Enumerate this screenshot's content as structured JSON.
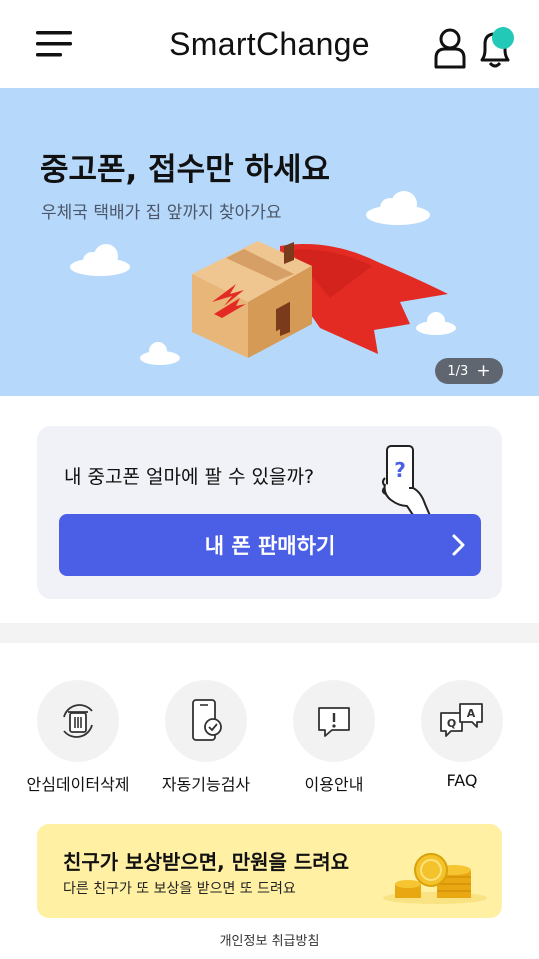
{
  "header": {
    "title": "SmartChange",
    "menu_icon": "hamburger-menu-icon",
    "user_icon": "user-icon",
    "bell_icon": "bell-icon",
    "notification_dot_color": "#22c9b6"
  },
  "hero": {
    "title": "중고폰, 접수만 하세요",
    "subtitle": "우체국 택배가 집 앞까지 찾아가요",
    "background": "#b6d9fb",
    "pager_text": "1/3",
    "pager_plus": "+"
  },
  "sell_card": {
    "question": "내 중고폰 얼마에 팔 수 있을까?",
    "button_label": "내 폰 판매하기",
    "button_color": "#4b5ee6"
  },
  "shortcuts": [
    {
      "label": "안심데이터삭제",
      "icon": "trash-refresh-icon"
    },
    {
      "label": "자동기능검사",
      "icon": "phone-check-icon"
    },
    {
      "label": "이용안내",
      "icon": "info-chat-icon"
    },
    {
      "label": "FAQ",
      "icon": "qa-bubbles-icon"
    }
  ],
  "promo": {
    "title": "친구가 보상받으면, 만원을 드려요",
    "subtitle": "다른 친구가 또 보상을 받으면 또 드려요",
    "background": "#fff0a3"
  },
  "footer": {
    "privacy_label": "개인정보 취급방침"
  }
}
